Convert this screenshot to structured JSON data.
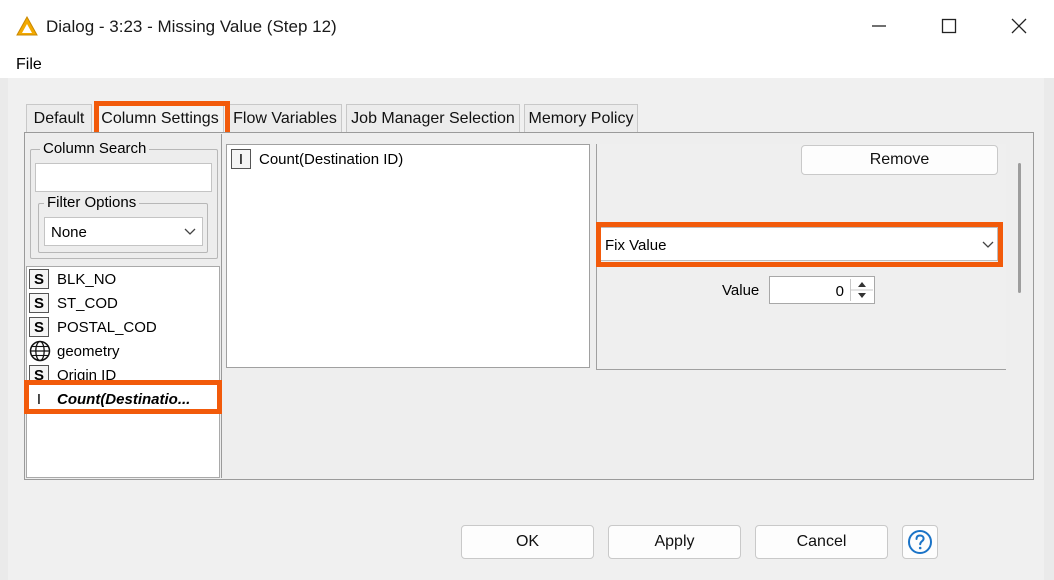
{
  "window": {
    "title": "Dialog - 3:23 - Missing Value (Step 12)",
    "accent_color": "#f2a900"
  },
  "menu": {
    "file": "File"
  },
  "tabs": [
    {
      "label": "Default",
      "active": false
    },
    {
      "label": "Column Settings",
      "active": true
    },
    {
      "label": "Flow Variables",
      "active": false
    },
    {
      "label": "Job Manager Selection",
      "active": false
    },
    {
      "label": "Memory Policy",
      "active": false
    }
  ],
  "left_panel": {
    "column_search_label": "Column Search",
    "column_search_value": "",
    "filter_options_label": "Filter Options",
    "filter_options_value": "None",
    "columns": [
      {
        "type": "S",
        "icon": "string-type-icon",
        "name": "BLK_NO"
      },
      {
        "type": "S",
        "icon": "string-type-icon",
        "name": "ST_COD"
      },
      {
        "type": "S",
        "icon": "string-type-icon",
        "name": "POSTAL_COD"
      },
      {
        "type": "",
        "icon": "globe-icon",
        "name": "geometry"
      },
      {
        "type": "S",
        "icon": "string-type-icon",
        "name": "Origin ID"
      },
      {
        "type": "I",
        "icon": "integer-type-icon",
        "name": "Count(Destinatio...",
        "selected": true
      }
    ]
  },
  "selected_columns": [
    {
      "type": "I",
      "name": "Count(Destination ID)"
    }
  ],
  "settings": {
    "remove_label": "Remove",
    "method_value": "Fix Value",
    "value_label": "Value",
    "value": "0"
  },
  "footer": {
    "ok": "OK",
    "apply": "Apply",
    "cancel": "Cancel",
    "help_icon": "help-icon"
  },
  "highlight_color": "#f25a0a"
}
